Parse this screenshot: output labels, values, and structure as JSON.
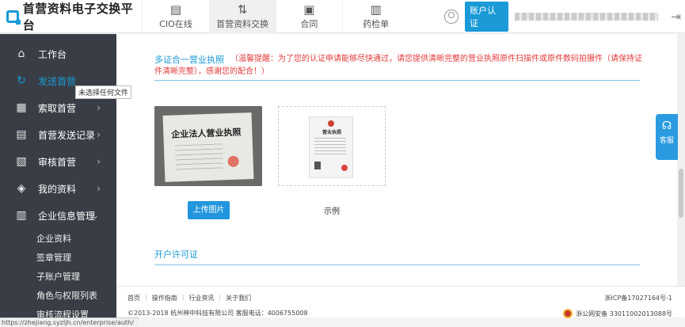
{
  "header": {
    "logo_text": "首营资料电子交换平台",
    "tabs": [
      {
        "label": "CIO在线",
        "icon": "document-icon"
      },
      {
        "label": "首营资料交换",
        "icon": "exchange-arrows-icon",
        "active": true
      },
      {
        "label": "合同",
        "icon": "contract-icon"
      },
      {
        "label": "药检单",
        "icon": "report-icon"
      }
    ],
    "auth_button": "账户认证"
  },
  "sidebar": {
    "items": [
      {
        "label": "工作台",
        "icon": "home-icon"
      },
      {
        "label": "发送首营",
        "icon": "refresh-icon",
        "active": true
      },
      {
        "label": "索取首营",
        "icon": "briefcase-icon"
      },
      {
        "label": "首营发送记录",
        "icon": "clipboard-icon"
      },
      {
        "label": "审核首营",
        "icon": "audit-icon"
      },
      {
        "label": "我的资料",
        "icon": "layers-icon"
      },
      {
        "label": "企业信息管理",
        "icon": "building-icon",
        "expanded": true
      }
    ],
    "sub_items": [
      "企业资料",
      "签章管理",
      "子账户管理",
      "角色与权限列表",
      "审核流程设置"
    ],
    "tooltip": "未选择任何文件"
  },
  "main": {
    "section_title": "多证合一营业执照",
    "notice": "（温馨提醒：为了您的认证申请能够尽快通过，请您提供清晰完整的营业执照原件扫描件或原件数码拍摄件（请保持证件清晰完整），感谢您的配合！）",
    "sample_caption": "企业法人营业执照",
    "upload_button": "上传图片",
    "example_doc_title": "营业执照",
    "example_label": "示例",
    "section2_title": "开户许可证"
  },
  "service": {
    "label": "客服"
  },
  "footer": {
    "links": [
      "首页",
      "操作指南",
      "行业资讯",
      "关于我们"
    ],
    "icp": "浙ICP备17027164号-1",
    "copyright": "©2013-2018  杭州神中科技有限公司   客服电话：4006755008",
    "police": "浙公网安备 33011002013088号"
  },
  "status_url": "https://zhejiang.syzljh.cn/enterprise/auth/"
}
